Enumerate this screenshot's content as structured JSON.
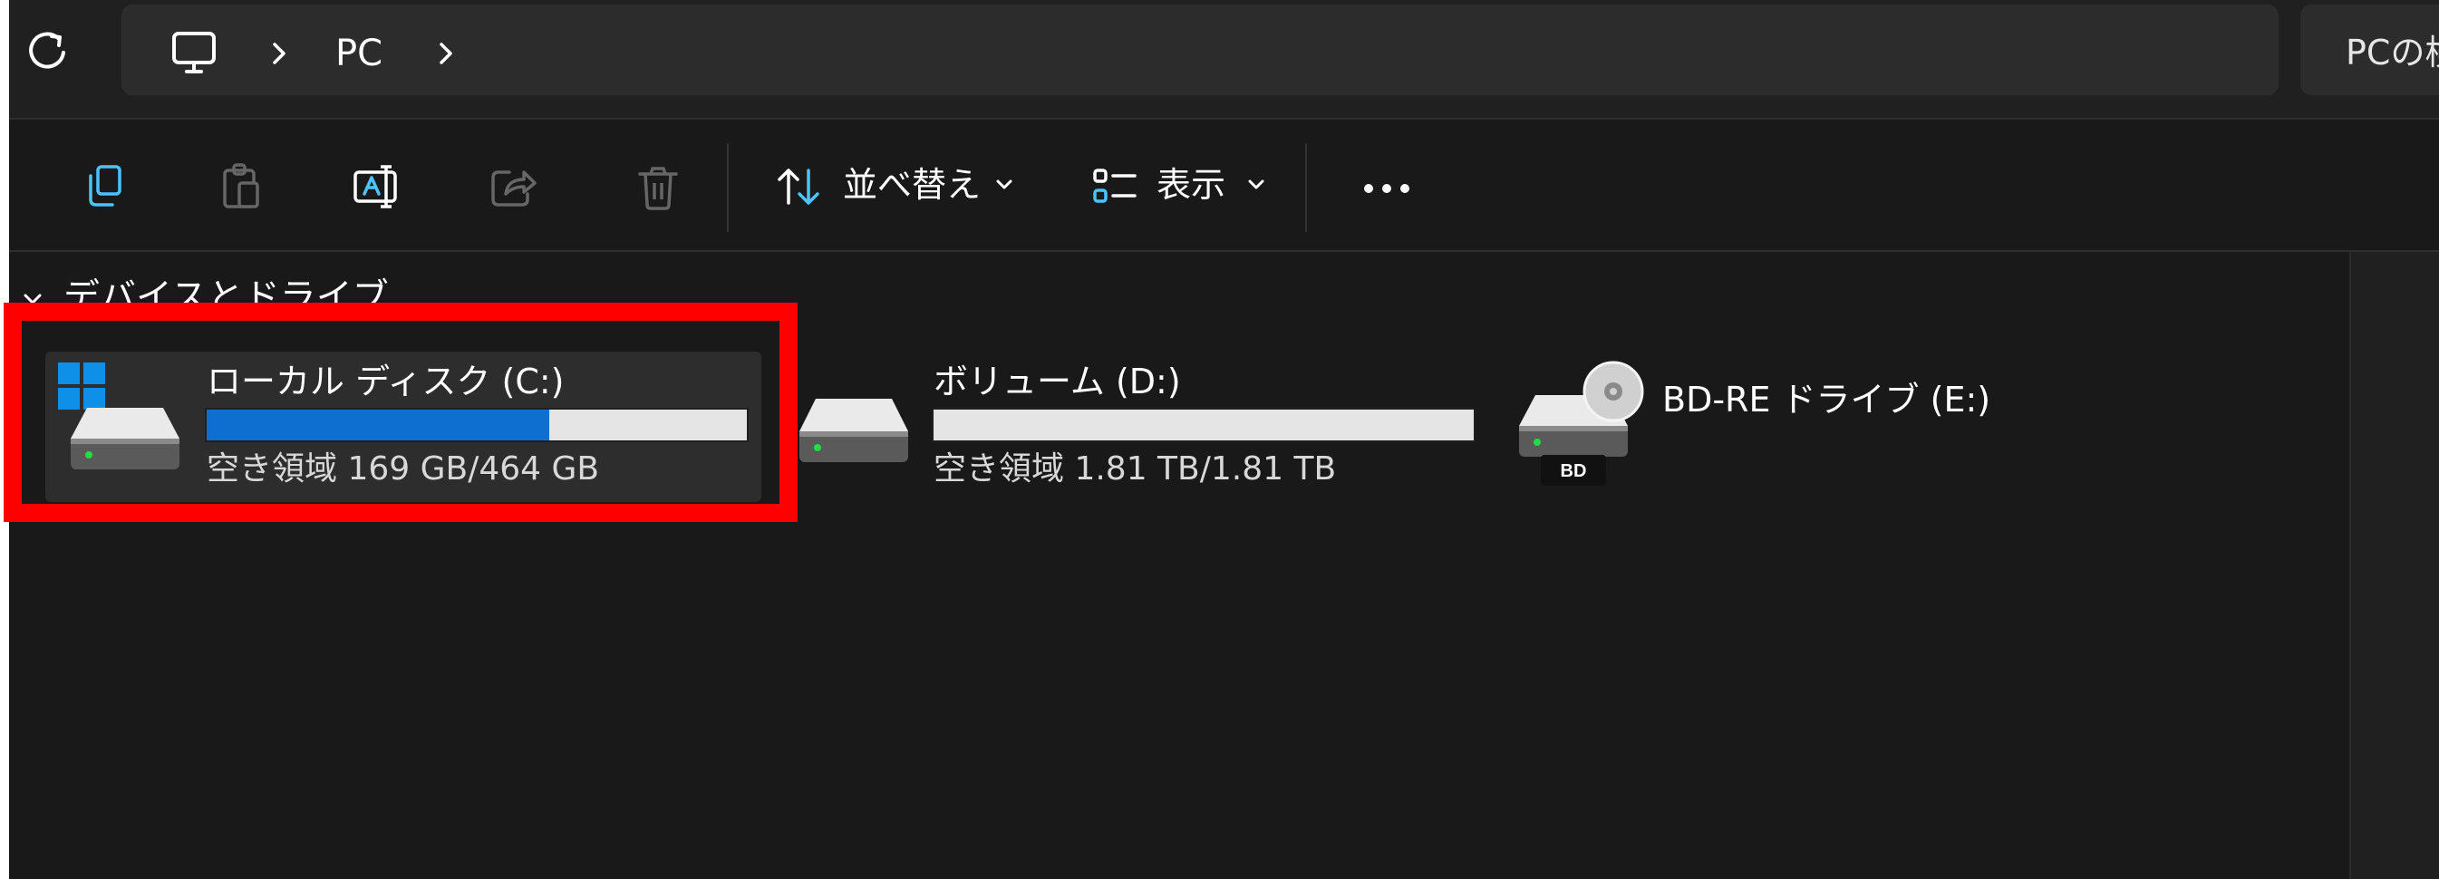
{
  "address_bar": {
    "breadcrumb": [
      "PC"
    ],
    "search_placeholder": "PCの検"
  },
  "toolbar": {
    "sort_label": "並べ替え",
    "view_label": "表示",
    "icons": [
      "copy-icon",
      "paste-icon",
      "rename-icon",
      "share-icon",
      "delete-icon",
      "sort-icon",
      "view-icon",
      "more-icon"
    ]
  },
  "section": {
    "title": "デバイスとドライブ"
  },
  "drives": [
    {
      "name": "ローカル ディスク (C:)",
      "free_text": "空き領域 169 GB/464 GB",
      "used_fraction": 0.635,
      "selected": true
    },
    {
      "name": "ボリューム (D:)",
      "free_text": "空き領域 1.81 TB/1.81 TB",
      "used_fraction": 0.0,
      "selected": false
    },
    {
      "name": "BD-RE ドライブ (E:)",
      "media_label": "BD"
    }
  ],
  "colors": {
    "background": "#191919",
    "usage_bar": "#0e6fd1",
    "highlight_frame": "#ff0000"
  }
}
